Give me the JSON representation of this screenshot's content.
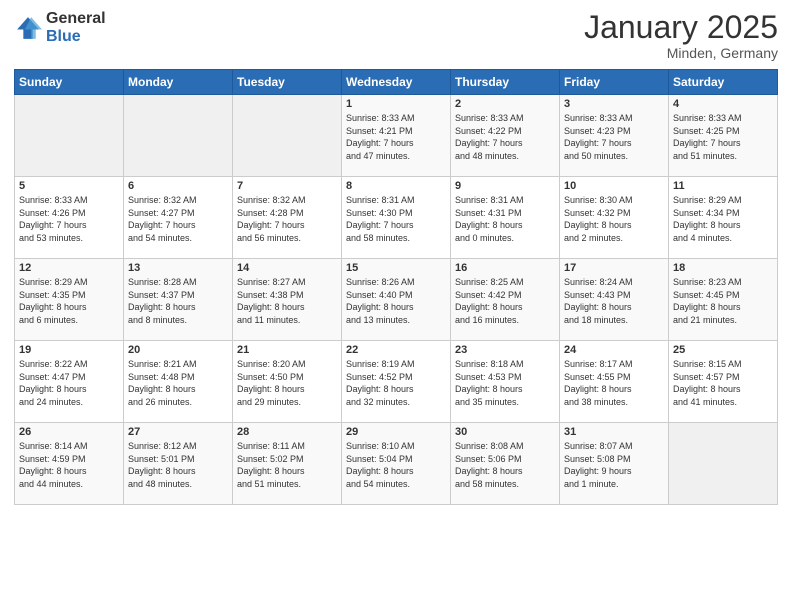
{
  "logo": {
    "general": "General",
    "blue": "Blue"
  },
  "header": {
    "month": "January 2025",
    "location": "Minden, Germany"
  },
  "weekdays": [
    "Sunday",
    "Monday",
    "Tuesday",
    "Wednesday",
    "Thursday",
    "Friday",
    "Saturday"
  ],
  "weeks": [
    [
      {
        "day": "",
        "info": ""
      },
      {
        "day": "",
        "info": ""
      },
      {
        "day": "",
        "info": ""
      },
      {
        "day": "1",
        "info": "Sunrise: 8:33 AM\nSunset: 4:21 PM\nDaylight: 7 hours\nand 47 minutes."
      },
      {
        "day": "2",
        "info": "Sunrise: 8:33 AM\nSunset: 4:22 PM\nDaylight: 7 hours\nand 48 minutes."
      },
      {
        "day": "3",
        "info": "Sunrise: 8:33 AM\nSunset: 4:23 PM\nDaylight: 7 hours\nand 50 minutes."
      },
      {
        "day": "4",
        "info": "Sunrise: 8:33 AM\nSunset: 4:25 PM\nDaylight: 7 hours\nand 51 minutes."
      }
    ],
    [
      {
        "day": "5",
        "info": "Sunrise: 8:33 AM\nSunset: 4:26 PM\nDaylight: 7 hours\nand 53 minutes."
      },
      {
        "day": "6",
        "info": "Sunrise: 8:32 AM\nSunset: 4:27 PM\nDaylight: 7 hours\nand 54 minutes."
      },
      {
        "day": "7",
        "info": "Sunrise: 8:32 AM\nSunset: 4:28 PM\nDaylight: 7 hours\nand 56 minutes."
      },
      {
        "day": "8",
        "info": "Sunrise: 8:31 AM\nSunset: 4:30 PM\nDaylight: 7 hours\nand 58 minutes."
      },
      {
        "day": "9",
        "info": "Sunrise: 8:31 AM\nSunset: 4:31 PM\nDaylight: 8 hours\nand 0 minutes."
      },
      {
        "day": "10",
        "info": "Sunrise: 8:30 AM\nSunset: 4:32 PM\nDaylight: 8 hours\nand 2 minutes."
      },
      {
        "day": "11",
        "info": "Sunrise: 8:29 AM\nSunset: 4:34 PM\nDaylight: 8 hours\nand 4 minutes."
      }
    ],
    [
      {
        "day": "12",
        "info": "Sunrise: 8:29 AM\nSunset: 4:35 PM\nDaylight: 8 hours\nand 6 minutes."
      },
      {
        "day": "13",
        "info": "Sunrise: 8:28 AM\nSunset: 4:37 PM\nDaylight: 8 hours\nand 8 minutes."
      },
      {
        "day": "14",
        "info": "Sunrise: 8:27 AM\nSunset: 4:38 PM\nDaylight: 8 hours\nand 11 minutes."
      },
      {
        "day": "15",
        "info": "Sunrise: 8:26 AM\nSunset: 4:40 PM\nDaylight: 8 hours\nand 13 minutes."
      },
      {
        "day": "16",
        "info": "Sunrise: 8:25 AM\nSunset: 4:42 PM\nDaylight: 8 hours\nand 16 minutes."
      },
      {
        "day": "17",
        "info": "Sunrise: 8:24 AM\nSunset: 4:43 PM\nDaylight: 8 hours\nand 18 minutes."
      },
      {
        "day": "18",
        "info": "Sunrise: 8:23 AM\nSunset: 4:45 PM\nDaylight: 8 hours\nand 21 minutes."
      }
    ],
    [
      {
        "day": "19",
        "info": "Sunrise: 8:22 AM\nSunset: 4:47 PM\nDaylight: 8 hours\nand 24 minutes."
      },
      {
        "day": "20",
        "info": "Sunrise: 8:21 AM\nSunset: 4:48 PM\nDaylight: 8 hours\nand 26 minutes."
      },
      {
        "day": "21",
        "info": "Sunrise: 8:20 AM\nSunset: 4:50 PM\nDaylight: 8 hours\nand 29 minutes."
      },
      {
        "day": "22",
        "info": "Sunrise: 8:19 AM\nSunset: 4:52 PM\nDaylight: 8 hours\nand 32 minutes."
      },
      {
        "day": "23",
        "info": "Sunrise: 8:18 AM\nSunset: 4:53 PM\nDaylight: 8 hours\nand 35 minutes."
      },
      {
        "day": "24",
        "info": "Sunrise: 8:17 AM\nSunset: 4:55 PM\nDaylight: 8 hours\nand 38 minutes."
      },
      {
        "day": "25",
        "info": "Sunrise: 8:15 AM\nSunset: 4:57 PM\nDaylight: 8 hours\nand 41 minutes."
      }
    ],
    [
      {
        "day": "26",
        "info": "Sunrise: 8:14 AM\nSunset: 4:59 PM\nDaylight: 8 hours\nand 44 minutes."
      },
      {
        "day": "27",
        "info": "Sunrise: 8:12 AM\nSunset: 5:01 PM\nDaylight: 8 hours\nand 48 minutes."
      },
      {
        "day": "28",
        "info": "Sunrise: 8:11 AM\nSunset: 5:02 PM\nDaylight: 8 hours\nand 51 minutes."
      },
      {
        "day": "29",
        "info": "Sunrise: 8:10 AM\nSunset: 5:04 PM\nDaylight: 8 hours\nand 54 minutes."
      },
      {
        "day": "30",
        "info": "Sunrise: 8:08 AM\nSunset: 5:06 PM\nDaylight: 8 hours\nand 58 minutes."
      },
      {
        "day": "31",
        "info": "Sunrise: 8:07 AM\nSunset: 5:08 PM\nDaylight: 9 hours\nand 1 minute."
      },
      {
        "day": "",
        "info": ""
      }
    ]
  ]
}
